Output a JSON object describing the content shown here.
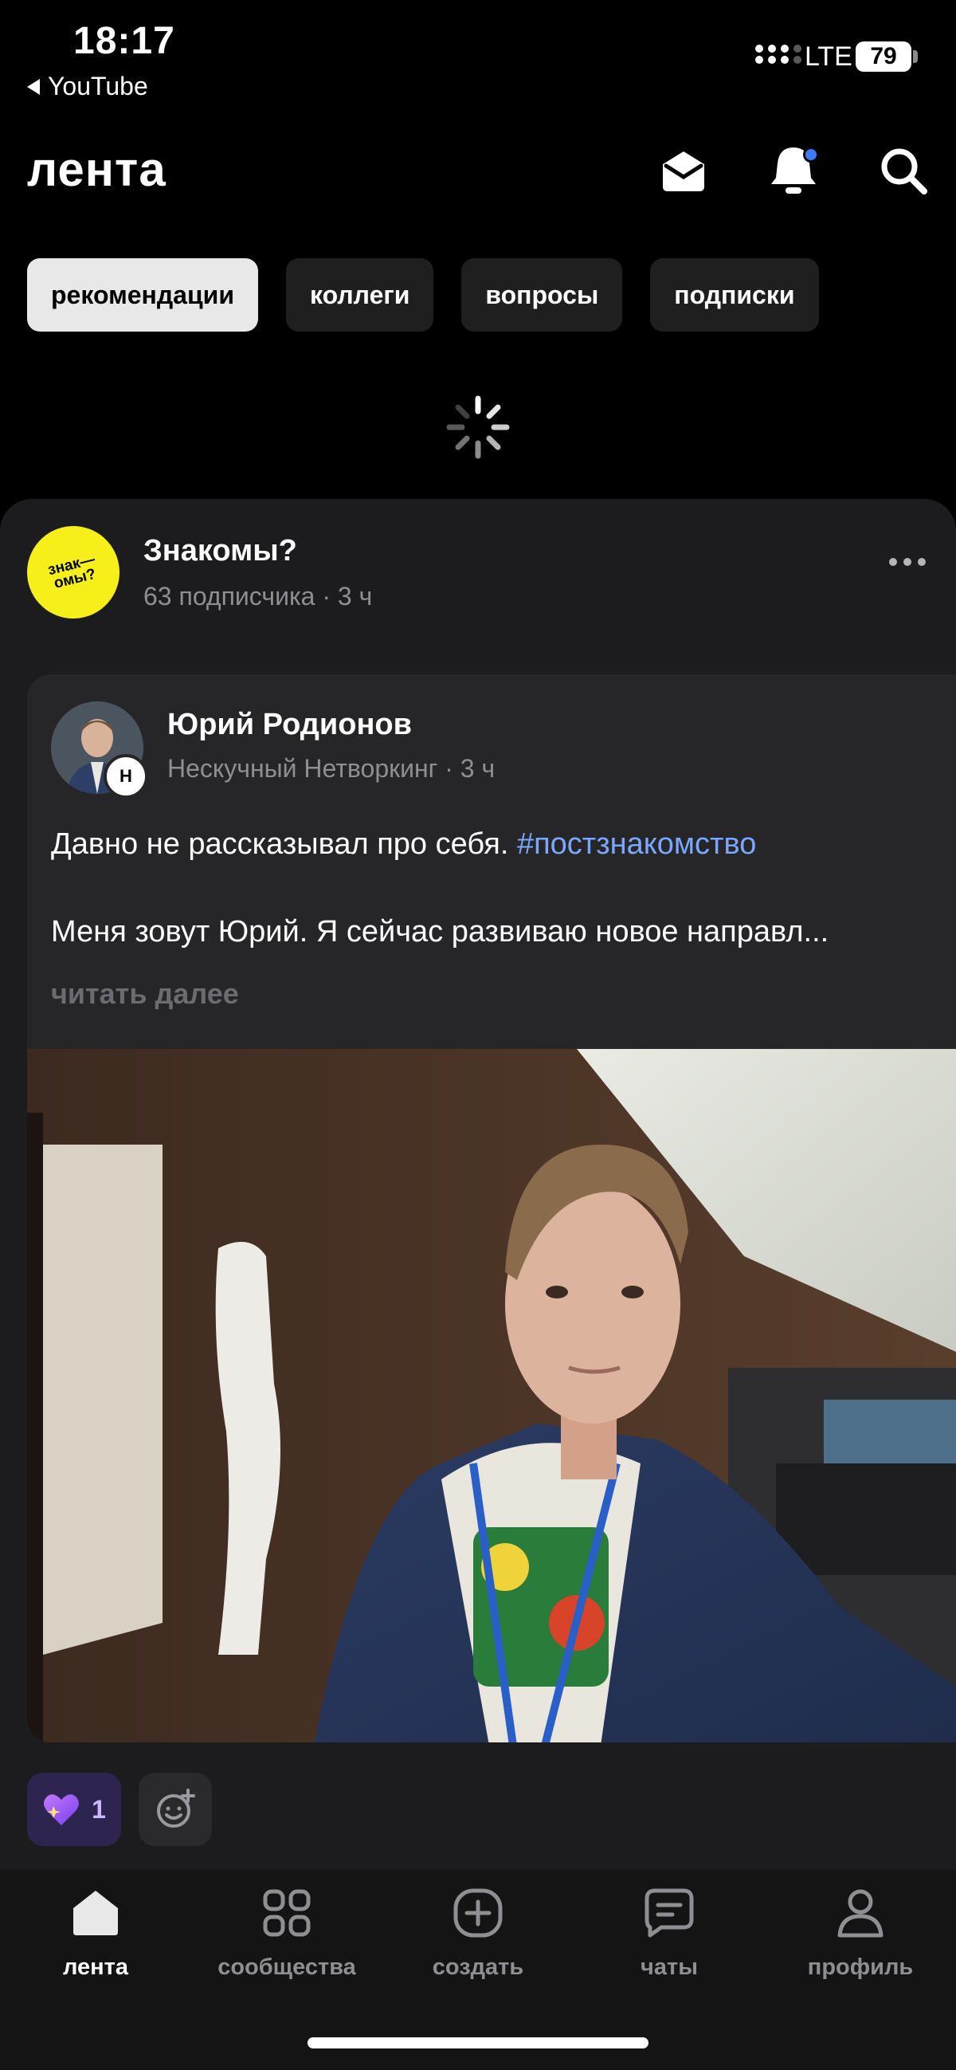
{
  "status_bar": {
    "time": "18:17",
    "back_app": "YouTube",
    "carrier": "LTE",
    "battery": "79"
  },
  "header": {
    "title": "лента",
    "icons": [
      "mail-icon",
      "bell-icon",
      "search-icon"
    ],
    "notification_dot_color": "#3a7bff"
  },
  "tabs": [
    {
      "label": "рекомендации",
      "active": true
    },
    {
      "label": "коллеги",
      "active": false
    },
    {
      "label": "вопросы",
      "active": false
    },
    {
      "label": "подписки",
      "active": false
    }
  ],
  "post": {
    "community": {
      "avatar_text": "знак— омы?",
      "name": "Знакомы?",
      "meta": "63 подписчика · 3 ч"
    },
    "author": {
      "name": "Юрий Родионов",
      "meta": "Нескучный Нетворкинг · 3 ч",
      "badge": "Н"
    },
    "text_line1": "Давно не рассказывал про себя.",
    "hashtag": "#постзнакомство",
    "text_line2": "Меня зовут Юрий. Я сейчас развиваю новое направл...",
    "read_more": "читать далее",
    "reaction_count": "1"
  },
  "bottom_nav": [
    {
      "label": "лента",
      "icon": "home-icon",
      "active": true
    },
    {
      "label": "сообщества",
      "icon": "grid-icon",
      "active": false
    },
    {
      "label": "создать",
      "icon": "plus-square-icon",
      "active": false
    },
    {
      "label": "чаты",
      "icon": "chat-icon",
      "active": false
    },
    {
      "label": "профиль",
      "icon": "profile-icon",
      "active": false
    }
  ],
  "colors": {
    "background": "#000000",
    "card": "#1c1c1e",
    "post": "#262628",
    "accent_link": "#7aa7ff",
    "community_avatar": "#f6ef1a",
    "reaction_bg": "#2d2550"
  }
}
